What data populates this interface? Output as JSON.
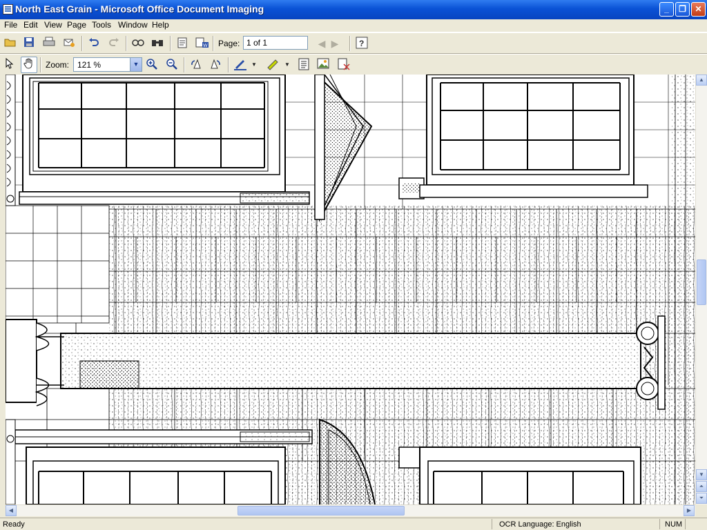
{
  "window": {
    "title": "North East Grain - Microsoft Office Document Imaging",
    "controls": {
      "minimize": "_",
      "restore": "❐",
      "close": "✕"
    }
  },
  "menu": {
    "items": [
      "File",
      "Edit",
      "View",
      "Page",
      "Tools",
      "Window",
      "Help"
    ]
  },
  "toolbar1": {
    "page_label": "Page:",
    "page_value": "1 of 1",
    "icons": [
      "open-icon",
      "save-icon",
      "print-icon",
      "send-icon",
      "undo-icon",
      "redo-icon",
      "read-icon",
      "find-icon",
      "recognize-icon",
      "send-to-word-icon",
      "previous-page-icon",
      "next-page-icon",
      "help-icon"
    ]
  },
  "toolbar2": {
    "zoom_label": "Zoom:",
    "zoom_value": "121 %",
    "icons": [
      "select-pointer-icon",
      "hand-pan-icon",
      "zoom-in-icon",
      "zoom-out-icon",
      "rotate-left-icon",
      "rotate-right-icon",
      "pen-icon",
      "highlighter-icon",
      "text-box-icon",
      "picture-icon",
      "annotation-options-icon"
    ]
  },
  "status": {
    "left": "Ready",
    "ocr": "OCR Language: English",
    "num": "NUM"
  }
}
